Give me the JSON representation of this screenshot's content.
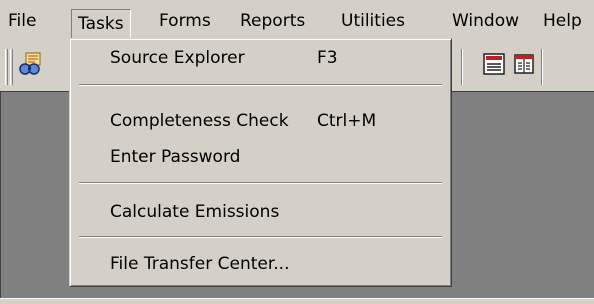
{
  "menubar": {
    "items": [
      {
        "label": "File"
      },
      {
        "label": "Tasks"
      },
      {
        "label": "Forms"
      },
      {
        "label": "Reports"
      },
      {
        "label": "Utilities"
      },
      {
        "label": "Window"
      },
      {
        "label": "Help"
      }
    ],
    "open_menu": "Tasks"
  },
  "toolbar": {
    "buttons": [
      {
        "icon": "binoculars-icon"
      },
      {
        "icon": "checklist-icon"
      },
      {
        "icon": "document-icon"
      }
    ]
  },
  "tasks_menu": {
    "items": [
      {
        "label": "Source Explorer",
        "shortcut": "F3"
      },
      {
        "label": "Completeness Check",
        "shortcut": "Ctrl+M"
      },
      {
        "label": "Enter Password",
        "shortcut": ""
      },
      {
        "label": "Calculate Emissions",
        "shortcut": ""
      },
      {
        "label": "File Transfer Center...",
        "shortcut": ""
      }
    ]
  },
  "colors": {
    "face": "#d4d0c8",
    "workspace": "#808080",
    "highlight": "#ffffff",
    "shadow": "#808080"
  }
}
